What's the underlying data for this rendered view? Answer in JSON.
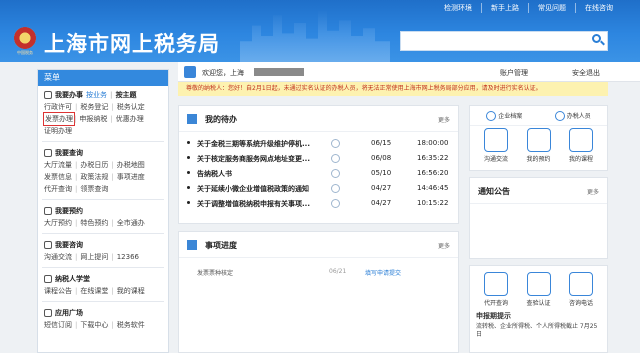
{
  "topnav": [
    "检测环境",
    "新手上路",
    "常见问题",
    "在线咨询"
  ],
  "header": {
    "site_title": "上海市网上税务局",
    "emblem_text": "中国税务"
  },
  "welcome": {
    "text": "欢迎您，上海",
    "account": "账户管理",
    "logout": "安全退出"
  },
  "banner": "尊敬的纳税人：您好！自2月1日起，未通过实名认证的办税人员，将无法正常使用上海市网上税务局部分应用，请及时进行实名认证。",
  "sidebar": {
    "title": "菜单",
    "groups": [
      {
        "title": "我要办事",
        "tags": [
          "按业务",
          "按主题"
        ],
        "rows": [
          [
            "行政许可",
            "税务登记",
            "税务认定"
          ],
          [
            "发票办理",
            "申报纳税",
            "优惠办理"
          ],
          [
            "证明办理"
          ]
        ]
      },
      {
        "title": "我要查询",
        "rows": [
          [
            "大厅流量",
            "办税日历",
            "办税地图"
          ],
          [
            "发票信息",
            "政策法规",
            "事项进度"
          ],
          [
            "代开查询",
            "领票查询"
          ]
        ]
      },
      {
        "title": "我要预约",
        "rows": [
          [
            "大厅预约",
            "特色预约",
            "全市通办"
          ]
        ]
      },
      {
        "title": "我要咨询",
        "rows": [
          [
            "沟通交流",
            "网上提问",
            "12366"
          ]
        ]
      },
      {
        "title": "纳税人学堂",
        "rows": [
          [
            "课程公告",
            "在线课堂",
            "我的课程"
          ]
        ]
      },
      {
        "title": "应用广场",
        "rows": [
          [
            "短信订阅",
            "下载中心",
            "税务软件"
          ]
        ]
      }
    ]
  },
  "todo": {
    "title": "我的待办",
    "more": "更多",
    "rows": [
      {
        "text": "关于金税三期等系统升级维护停机...",
        "date": "06/15",
        "time": "18:00:00"
      },
      {
        "text": "关于核定服务商服务网点地址变更...",
        "date": "06/08",
        "time": "16:35:22"
      },
      {
        "text": "告纳税人书",
        "date": "05/10",
        "time": "16:56:20"
      },
      {
        "text": "关于延续小微企业增值税政策的通知",
        "date": "04/27",
        "time": "14:46:45"
      },
      {
        "text": "关于调整增值税纳税申报有关事项...",
        "date": "04/27",
        "time": "10:15:22"
      }
    ]
  },
  "progress": {
    "title": "事项进度",
    "more": "更多",
    "rows": [
      {
        "text": "发票票种核定",
        "date": "06/21",
        "link": "填写申请提交"
      }
    ]
  },
  "right": {
    "roles": [
      "企业档案",
      "办税人员"
    ],
    "icons": [
      "沟通交流",
      "我的预约",
      "我的课程"
    ],
    "notice_title": "通知公告",
    "notice_more": "更多",
    "bottom_icons": [
      "代开查询",
      "查验认证",
      "咨询电话"
    ],
    "hint_title": "申报期提示",
    "hint_text": "流转税、企业所得税、个人所得税截止 7月25日"
  }
}
